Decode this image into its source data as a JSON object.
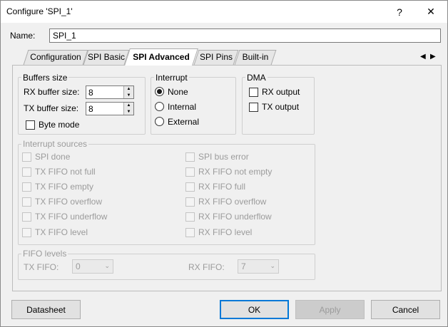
{
  "window": {
    "title": "Configure 'SPI_1'",
    "help_glyph": "?",
    "close_glyph": "✕"
  },
  "name_field": {
    "label": "Name:",
    "value": "SPI_1"
  },
  "tabs": [
    {
      "label": "Configuration"
    },
    {
      "label": "SPI Basic"
    },
    {
      "label": "SPI Advanced"
    },
    {
      "label": "SPI Pins"
    },
    {
      "label": "Built-in"
    }
  ],
  "tab_scroll": {
    "left": "◀",
    "right": "▶"
  },
  "buffers": {
    "title": "Buffers size",
    "rx_label": "RX buffer size:",
    "rx_value": "8",
    "tx_label": "TX buffer size:",
    "tx_value": "8",
    "byte_mode_label": "Byte mode"
  },
  "interrupt": {
    "title": "Interrupt",
    "options": [
      "None",
      "Internal",
      "External"
    ],
    "selected": "None"
  },
  "dma": {
    "title": "DMA",
    "rx_label": "RX output",
    "tx_label": "TX output"
  },
  "interrupt_sources": {
    "title": "Interrupt sources",
    "left": [
      "SPI done",
      "TX FIFO not full",
      "TX FIFO empty",
      "TX FIFO overflow",
      "TX FIFO underflow",
      "TX FIFO level"
    ],
    "right": [
      "SPI bus error",
      "RX FIFO not empty",
      "RX FIFO full",
      "RX FIFO overflow",
      "RX FIFO underflow",
      "RX FIFO level"
    ]
  },
  "fifo_levels": {
    "title": "FIFO levels",
    "tx_label": "TX FIFO:",
    "tx_value": "0",
    "rx_label": "RX FIFO:",
    "rx_value": "7"
  },
  "buttons": {
    "datasheet": "Datasheet",
    "ok": "OK",
    "apply": "Apply",
    "cancel": "Cancel"
  }
}
